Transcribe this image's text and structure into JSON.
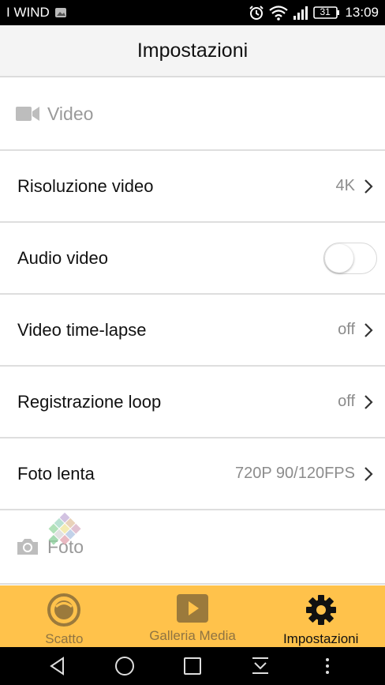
{
  "status_bar": {
    "carrier": "I WIND",
    "battery": "31",
    "time": "13:09",
    "icons": [
      "image-icon",
      "alarm-icon",
      "wifi-icon",
      "signal-icon",
      "battery-icon"
    ]
  },
  "header": {
    "title": "Impostazioni"
  },
  "sections": {
    "video": {
      "label": "Video",
      "icon": "video-camera-icon"
    },
    "foto": {
      "label": "Foto",
      "icon": "camera-icon"
    }
  },
  "rows": [
    {
      "label": "Risoluzione video",
      "value": "4K"
    },
    {
      "label": "Audio video",
      "toggle": false
    },
    {
      "label": "Video time-lapse",
      "value": "off"
    },
    {
      "label": "Registrazione loop",
      "value": "off"
    },
    {
      "label": "Foto lenta",
      "value": "720P 90/120FPS"
    }
  ],
  "tabs": [
    {
      "label": "Scatto",
      "icon": "shutter-icon",
      "active": false
    },
    {
      "label": "Galleria Media",
      "icon": "play-icon",
      "active": false
    },
    {
      "label": "Impostazioni",
      "icon": "gear-icon",
      "active": true
    }
  ],
  "nav": [
    "back-icon",
    "home-icon",
    "recents-icon",
    "notification-pull-icon",
    "more-icon"
  ],
  "colors": {
    "tab_bar": "#ffc24b",
    "tab_icon_inactive": "#9b7a3c",
    "active_tab": "#111111"
  }
}
